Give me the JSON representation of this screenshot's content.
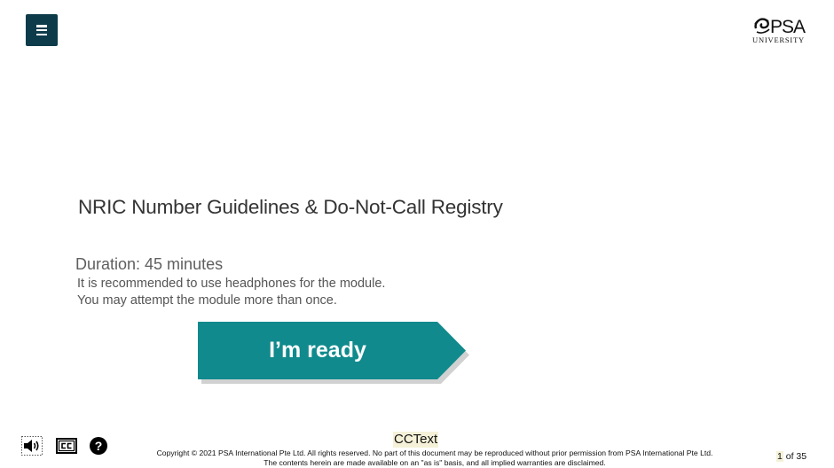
{
  "header": {
    "menu_icon": "hamburger-menu-icon",
    "logo": {
      "name": "PSA",
      "subtitle": "UNIVERSITY",
      "icon": "psa-swirl-logo-icon"
    }
  },
  "main": {
    "title": "NRIC Number Guidelines & Do-Not-Call Registry",
    "duration": "Duration: 45 minutes",
    "notes": [
      "It is recommended to use headphones for the module.",
      "You may attempt the module more than once."
    ],
    "ready_button": {
      "label": "I’m ready",
      "color": "#108a8d"
    }
  },
  "footer": {
    "icons": [
      "speaker-icon",
      "closed-captions-icon",
      "help-icon"
    ],
    "help_glyph": "?",
    "cc_text": "CCText",
    "copyright_lines": [
      "Copyright © 2021 PSA International Pte Ltd. All rights reserved. No part of this document may be reproduced without prior permission from PSA International Pte Ltd.",
      "The contents herein are made available on an \"as is\" basis, and all implied warranties are disclaimed."
    ],
    "page": {
      "current": "1",
      "of_label": " of 35"
    }
  },
  "colors": {
    "menu_bg": "#0d3b4a",
    "accent": "#108a8d",
    "cc_highlight": "#f5f1d8"
  }
}
